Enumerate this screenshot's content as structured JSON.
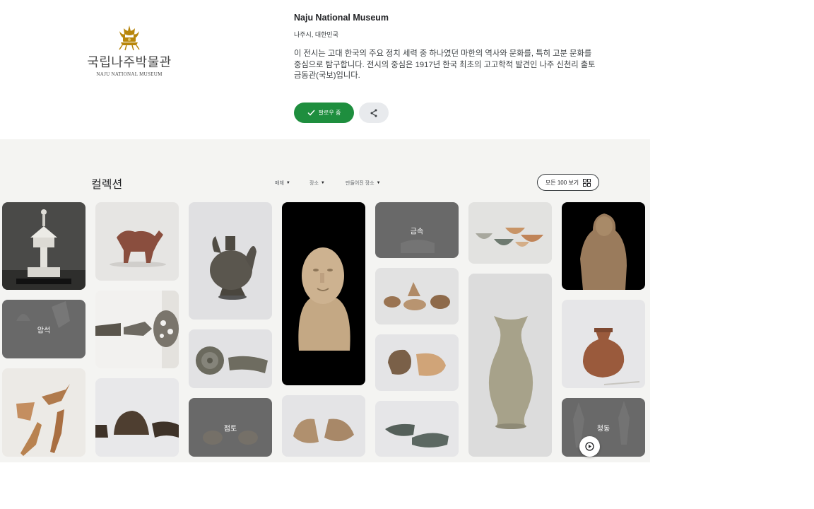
{
  "header": {
    "logo_ko": "국립나주박물관",
    "logo_en": "NAJU NATIONAL MUSEUM",
    "museum_name": "Naju National Museum",
    "location": "나주시, 대한민국",
    "description": "이 전시는 고대 한국의 주요 정치 세력 중 하나였던 마한의 역사와 문화를, 특히 고분 문화를 중심으로 탐구합니다. 전시의 중심은 1917년 한국 최초의 고고학적 발견인 나주 신천리 출토 금동관(국보)입니다.",
    "follow_label": "팔로우 중",
    "icons": {
      "follow": "check-icon",
      "share": "share-icon"
    }
  },
  "collection": {
    "title": "컬렉션",
    "filters": [
      "매체",
      "장소",
      "만들어진 장소"
    ],
    "view_all": "모든 100 보기",
    "categories": {
      "stone": "암석",
      "metal": "금속",
      "earth": "점토",
      "bronze": "청동"
    },
    "icons": {
      "view_all": "grid-icon",
      "play": "play-icon",
      "filter": "caret-down-icon"
    }
  },
  "colors": {
    "accent": "#1e8e3e",
    "band": "#f4f4f2",
    "category_overlay": "#696969"
  }
}
